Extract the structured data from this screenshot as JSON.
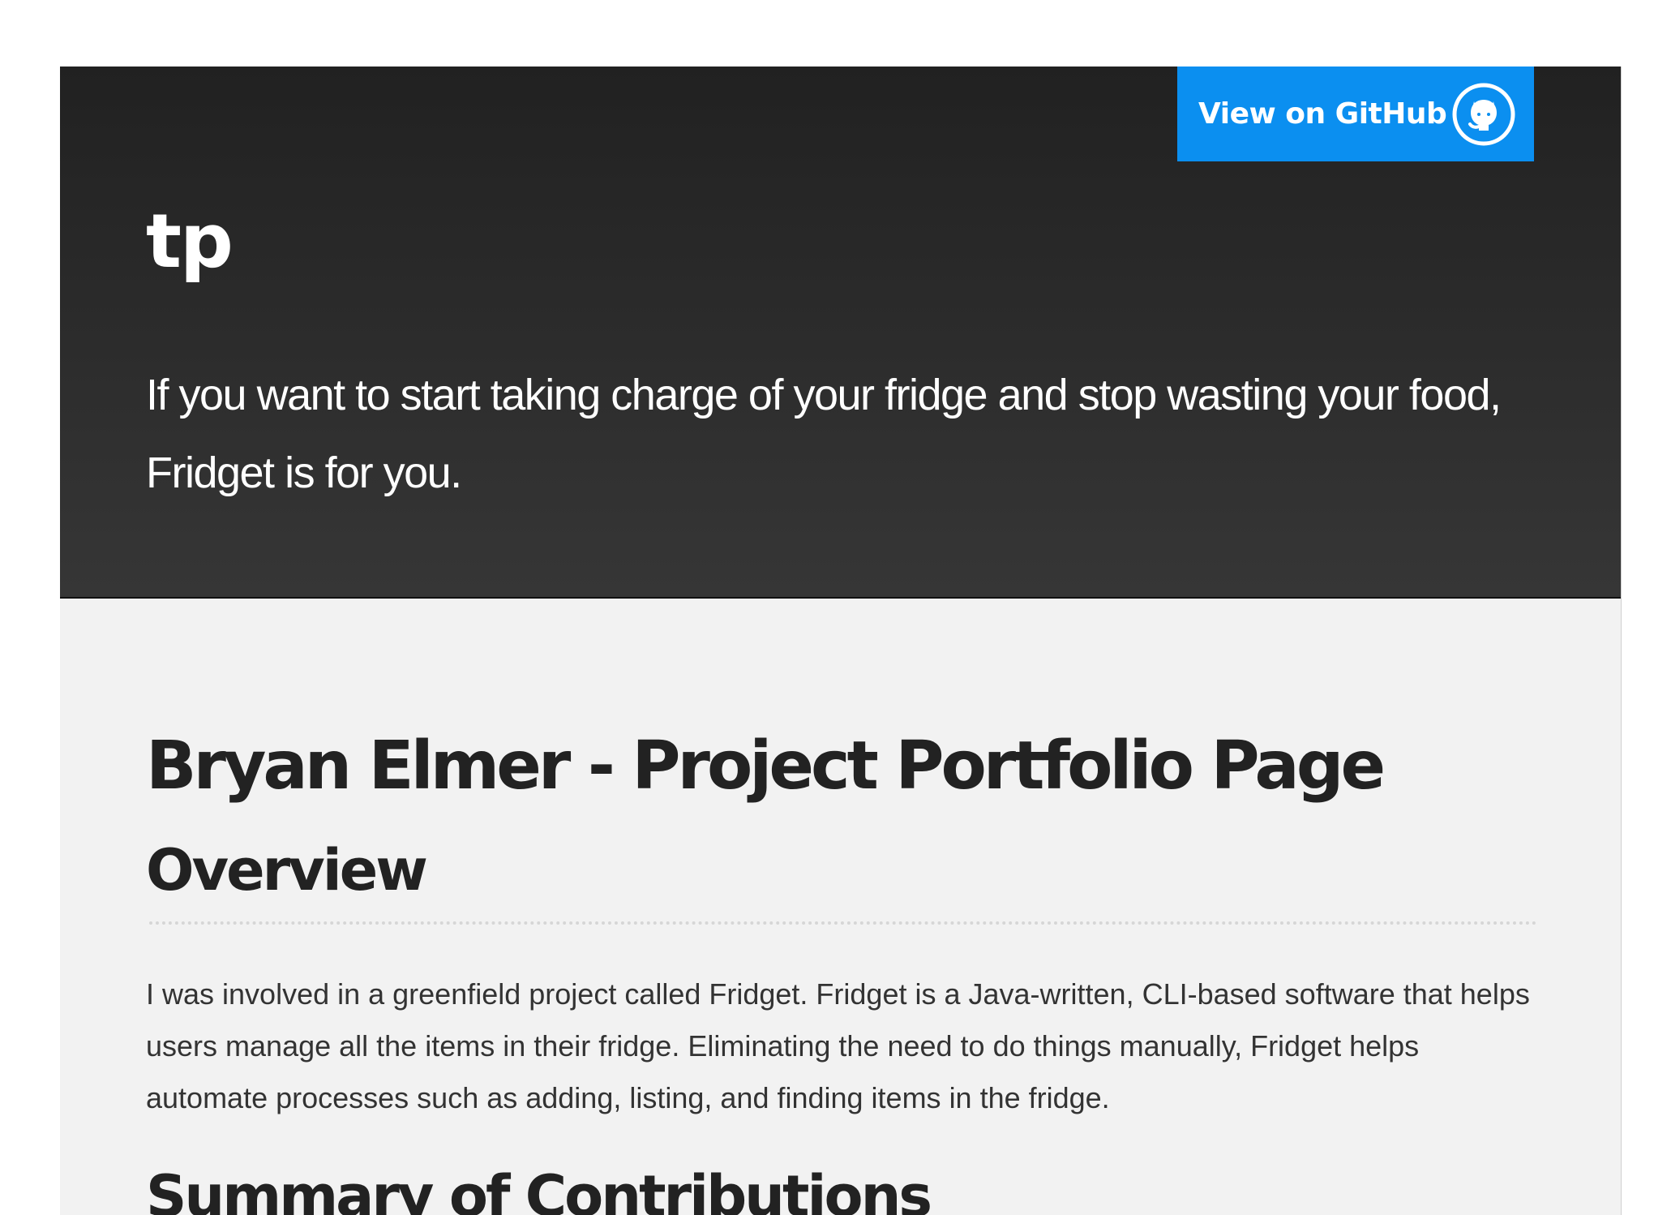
{
  "header": {
    "github_button_label": "View on GitHub",
    "site_title": "tp",
    "tagline": "If you want to start taking charge of your fridge and stop wasting your food, Fridget is for you."
  },
  "main": {
    "page_title": "Bryan Elmer - Project Portfolio Page",
    "overview_heading": "Overview",
    "overview_text": "I was involved in a greenfield project called Fridget. Fridget is a Java-written, CLI-based software that helps users manage all the items in their fridge. Eliminating the need to do things manually, Fridget helps automate processes such as adding, listing, and finding items in the fridge.",
    "next_heading_partial": "Summary of Contributions"
  },
  "icons": {
    "github": "github-octocat-icon"
  },
  "colors": {
    "header_bg_top": "#212121",
    "header_bg_bottom": "#363636",
    "github_button": "#0b8ff0",
    "content_bg": "#f2f2f2",
    "heading_text": "#222222",
    "body_text": "#333333"
  }
}
